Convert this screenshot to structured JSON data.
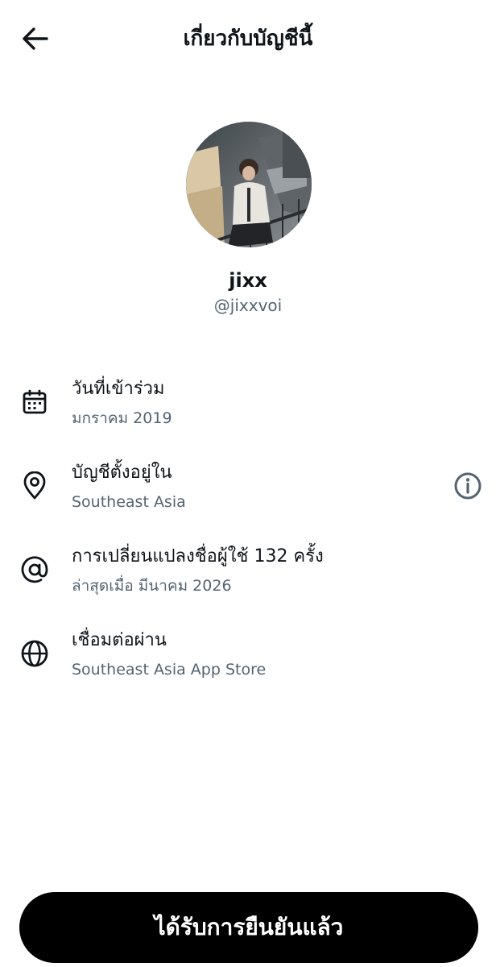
{
  "header": {
    "title": "เกี่ยวกับบัญชีนี้",
    "back_icon": "arrow-left-icon"
  },
  "profile": {
    "display_name": "jixx",
    "handle": "@jixxvoi",
    "avatar_icon": "profile-photo"
  },
  "rows": [
    {
      "icon": "calendar-icon",
      "title": "วันที่เข้าร่วม",
      "subtitle": "มกราคม 2019"
    },
    {
      "icon": "location-pin-icon",
      "title": "บัญชีตั้งอยู่ใน",
      "subtitle": "Southeast Asia",
      "action_icon": "info-icon"
    },
    {
      "icon": "at-sign-icon",
      "title": "การเปลี่ยนแปลงชื่อผู้ใช้ 132 ครั้ง",
      "subtitle": "ล่าสุดเมื่อ มีนาคม 2026"
    },
    {
      "icon": "globe-icon",
      "title": "เชื่อมต่อผ่าน",
      "subtitle": "Southeast Asia App Store"
    }
  ],
  "footer": {
    "button_label": "ได้รับการยืนยันแล้ว"
  },
  "colors": {
    "text_primary": "#0f1419",
    "text_secondary": "#536471",
    "button_bg": "#000000",
    "button_text": "#ffffff"
  }
}
